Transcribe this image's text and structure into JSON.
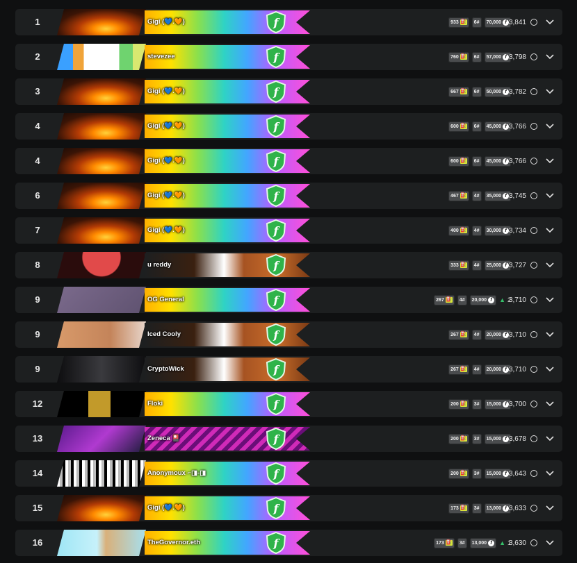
{
  "colors": {
    "row_bg": "#1d1f20",
    "chip_bg": "#4a4c4e",
    "gas_icon": "#d9e93a",
    "shield": "#2fb34a",
    "up": "#36c06a"
  },
  "icons": {
    "gas": "gas-pump-icon",
    "flag": "f-coin-icon",
    "points": "circle-outline-icon",
    "expand": "chevron-down-icon",
    "rank_up": "triangle-up-icon",
    "badge": "shield-f-icon"
  },
  "leaderboard": [
    {
      "rank": "1",
      "name": "Gigi (💙.🧡)",
      "gas": "933",
      "level": "6#",
      "tokens": "70,000",
      "delta": "",
      "score": "3,841",
      "avatar": "sunset",
      "banner": "rainbow"
    },
    {
      "rank": "2",
      "name": "stevezee",
      "gas": "760",
      "level": "6#",
      "tokens": "57,000",
      "delta": "",
      "score": "3,798",
      "avatar": "pixel",
      "banner": "rainbow"
    },
    {
      "rank": "3",
      "name": "Gigi (💙.🧡)",
      "gas": "667",
      "level": "6#",
      "tokens": "50,000",
      "delta": "",
      "score": "3,782",
      "avatar": "sunset",
      "banner": "rainbow"
    },
    {
      "rank": "4",
      "name": "Gigi (💙.🧡)",
      "gas": "600",
      "level": "6#",
      "tokens": "45,000",
      "delta": "",
      "score": "3,766",
      "avatar": "sunset",
      "banner": "rainbow"
    },
    {
      "rank": "4",
      "name": "Gigi (💙.🧡)",
      "gas": "600",
      "level": "6#",
      "tokens": "45,000",
      "delta": "",
      "score": "3,766",
      "avatar": "sunset",
      "banner": "rainbow"
    },
    {
      "rank": "6",
      "name": "Gigi (💙.🧡)",
      "gas": "467",
      "level": "4#",
      "tokens": "35,000",
      "delta": "",
      "score": "3,745",
      "avatar": "sunset",
      "banner": "rainbow"
    },
    {
      "rank": "7",
      "name": "Gigi (💙.🧡)",
      "gas": "400",
      "level": "4#",
      "tokens": "30,000",
      "delta": "",
      "score": "3,734",
      "avatar": "sunset",
      "banner": "rainbow"
    },
    {
      "rank": "8",
      "name": "u reddy",
      "gas": "333",
      "level": "4#",
      "tokens": "25,000",
      "delta": "",
      "score": "3,727",
      "avatar": "red",
      "banner": "bronze"
    },
    {
      "rank": "9",
      "name": "OG General",
      "gas": "267",
      "level": "4#",
      "tokens": "20,000",
      "delta": "2",
      "score": "3,710",
      "avatar": "ape",
      "banner": "rainbow"
    },
    {
      "rank": "9",
      "name": "Iced Cooly",
      "gas": "267",
      "level": "4#",
      "tokens": "20,000",
      "delta": "",
      "score": "3,710",
      "avatar": "cooly",
      "banner": "bronze"
    },
    {
      "rank": "9",
      "name": "CryptoWick",
      "gas": "267",
      "level": "4#",
      "tokens": "20,000",
      "delta": "",
      "score": "3,710",
      "avatar": "wick",
      "banner": "bronze"
    },
    {
      "rank": "12",
      "name": "Floki",
      "gas": "200",
      "level": "3#",
      "tokens": "15,000",
      "delta": "",
      "score": "3,700",
      "avatar": "floki",
      "banner": "rainbow"
    },
    {
      "rank": "13",
      "name": "Zeneca 🎴",
      "gas": "200",
      "level": "3#",
      "tokens": "15,000",
      "delta": "",
      "score": "3,678",
      "avatar": "zeneca",
      "banner": "pink"
    },
    {
      "rank": "14",
      "name": "Anonymoux ⌐◨-◨",
      "gas": "200",
      "level": "3#",
      "tokens": "15,000",
      "delta": "",
      "score": "3,643",
      "avatar": "noggles",
      "banner": "rainbow"
    },
    {
      "rank": "15",
      "name": "Gigi (💙.🧡)",
      "gas": "173",
      "level": "3#",
      "tokens": "13,000",
      "delta": "",
      "score": "3,633",
      "avatar": "sunset",
      "banner": "rainbow"
    },
    {
      "rank": "16",
      "name": "TheGovernor.eth",
      "gas": "173",
      "level": "3#",
      "tokens": "13,000",
      "delta": "1",
      "score": "3,630",
      "avatar": "governor",
      "banner": "rainbow"
    }
  ]
}
